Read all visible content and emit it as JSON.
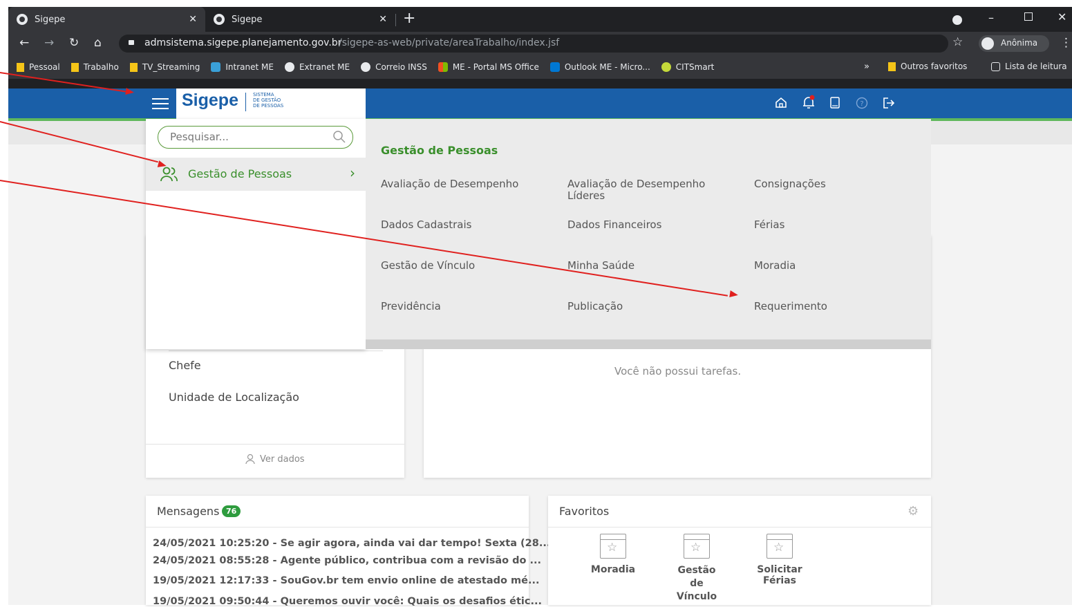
{
  "browser": {
    "tabs": [
      {
        "title": "Sigepe"
      },
      {
        "title": "Sigepe"
      }
    ],
    "new_tab": "+",
    "url_host": "admsistema.sigepe.planejamento.gov.br",
    "url_path": "/sigepe-as-web/private/areaTrabalho/index.jsf",
    "profile_label": "Anônima",
    "bookmarks": [
      {
        "label": "Pessoal",
        "icon": "folder-icon"
      },
      {
        "label": "Trabalho",
        "icon": "folder-icon"
      },
      {
        "label": "TV_Streaming",
        "icon": "folder-icon"
      },
      {
        "label": "Intranet ME",
        "icon": "intranet-icon"
      },
      {
        "label": "Extranet ME",
        "icon": "wordpress-icon"
      },
      {
        "label": "Correio INSS",
        "icon": "globe-icon"
      },
      {
        "label": "ME - Portal MS Office",
        "icon": "office-icon"
      },
      {
        "label": "Outlook ME - Micro...",
        "icon": "outlook-icon"
      },
      {
        "label": "CITSmart",
        "icon": "citsmart-icon"
      }
    ],
    "more_bookmarks": "»",
    "other_favorites": "Outros favoritos",
    "reading_list": "Lista de leitura"
  },
  "app": {
    "logo": "Sigepe",
    "logo_sub_1": "SISTEMA",
    "logo_sub_2": "DE GESTÃO",
    "logo_sub_3": "DE PESSOAS"
  },
  "menu": {
    "search_placeholder": "Pesquisar...",
    "left_item": "Gestão de Pessoas",
    "section_title": "Gestão de Pessoas",
    "items": [
      "Avaliação de Desempenho",
      "Avaliação de Desempenho Líderes",
      "Consignações",
      "Dados Cadastrais",
      "Dados Financeiros",
      "Férias",
      "Gestão de Vínculo",
      "Minha Saúde",
      "Moradia",
      "Previdência",
      "Publicação",
      "Requerimento"
    ]
  },
  "profile_card": {
    "field_chefe": "Chefe",
    "field_unidade": "Unidade de Localização",
    "ver_dados": "Ver dados"
  },
  "tasks_card": {
    "empty": "Você não possui tarefas."
  },
  "messages": {
    "title": "Mensagens",
    "count": "76",
    "items": [
      "24/05/2021 10:25:20 - Se agir agora, ainda vai dar tempo! Sexta (28...",
      "24/05/2021 08:55:28 - Agente público, contribua com a revisão do ...",
      "19/05/2021 12:17:33 - SouGov.br tem envio online de atestado mé...",
      "19/05/2021 09:50:44 - Queremos ouvir você: Quais os desafios étic..."
    ]
  },
  "favorites": {
    "title": "Favoritos",
    "items": [
      "Moradia",
      "Gestão de Vínculo",
      "Solicitar Férias"
    ]
  },
  "colors": {
    "appbar": "#1a5fa8",
    "accent_green": "#3a8f2c",
    "annotation_red": "#e0201e"
  }
}
